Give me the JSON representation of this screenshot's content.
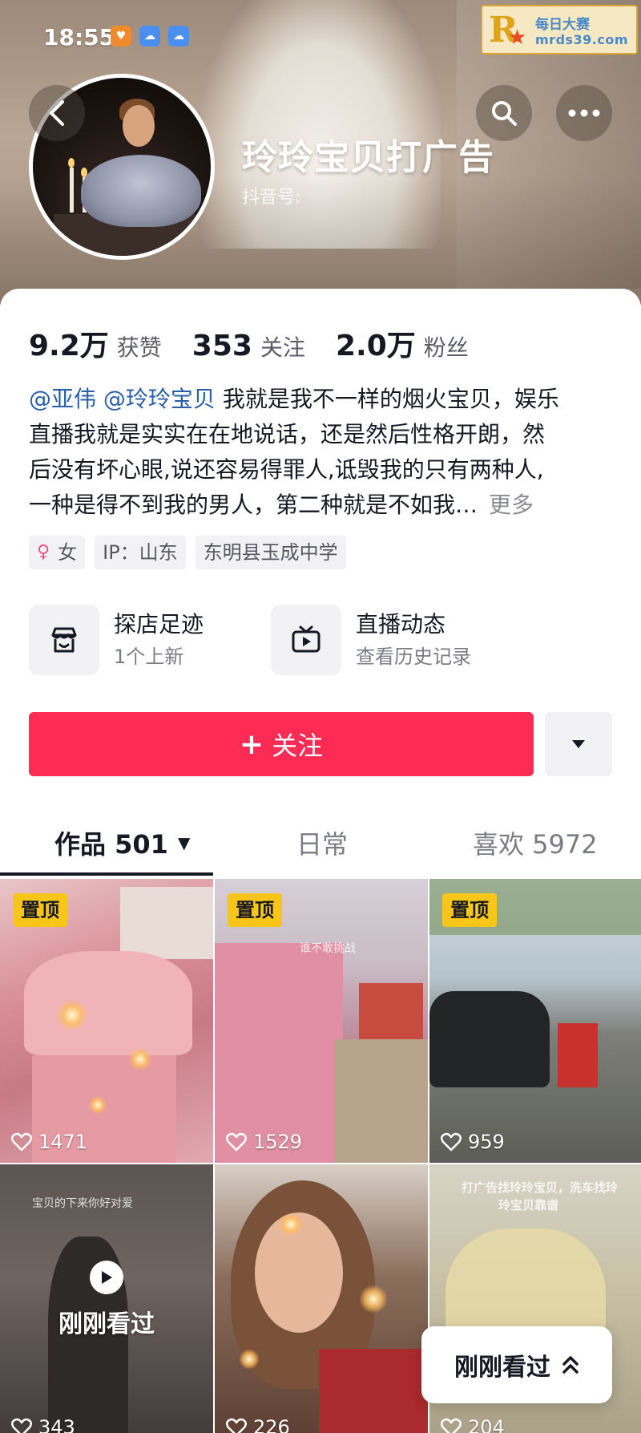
{
  "status_bar": {
    "time": "18:55"
  },
  "watermark": {
    "logo_letter": "R",
    "line1": "每日大赛",
    "line2": "mrds39.com"
  },
  "profile": {
    "nickname": "玲玲宝贝打广告",
    "douyin_id_label": "抖音号:",
    "stats": [
      {
        "value": "9.2万",
        "label": "获赞"
      },
      {
        "value": "353",
        "label": "关注"
      },
      {
        "value": "2.0万",
        "label": "粉丝"
      }
    ],
    "bio": {
      "mentions": [
        "@亚伟",
        "@玲玲宝贝"
      ],
      "line1_rest": "我就是我不一样的烟火宝贝，娱乐",
      "line2": "直播我就是实实在在地说话，还是然后性格开朗，然",
      "line3": "后没有坏心眼,说还容易得罪人,诋毁我的只有两种人,",
      "line4": "一种是得不到我的男人，第二种就是不如我…",
      "more": "更多"
    },
    "tags": {
      "gender": "女",
      "ip": "IP：山东",
      "school": "东明县玉成中学"
    }
  },
  "entries": [
    {
      "title": "探店足迹",
      "subtitle": "1个上新",
      "icon": "shop-icon"
    },
    {
      "title": "直播动态",
      "subtitle": "查看历史记录",
      "icon": "tv-icon"
    }
  ],
  "actions": {
    "follow_label": "关注",
    "dropdown_icon": "caret-down-icon"
  },
  "tabs": {
    "works": "作品 501",
    "daily": "日常",
    "likes": "喜欢 5972"
  },
  "videos": [
    {
      "pinned": "置顶",
      "likes": "1471"
    },
    {
      "pinned": "置顶",
      "likes": "1529",
      "overlay": "谁不敢挑战"
    },
    {
      "pinned": "置顶",
      "likes": "959"
    },
    {
      "likes": "343",
      "recent": "刚刚看过",
      "overlay": "宝贝的下来你好对爱"
    },
    {
      "likes": "226"
    },
    {
      "likes": "204",
      "overlay1": "打广告找玲玲宝贝，洗车找玲",
      "overlay2": "玲宝贝靠谱"
    }
  ],
  "floating": {
    "recent_label": "刚刚看过"
  },
  "colors": {
    "accent": "#fe2c55",
    "pin_badge": "#f8c619",
    "mention": "#2a5ea8"
  }
}
